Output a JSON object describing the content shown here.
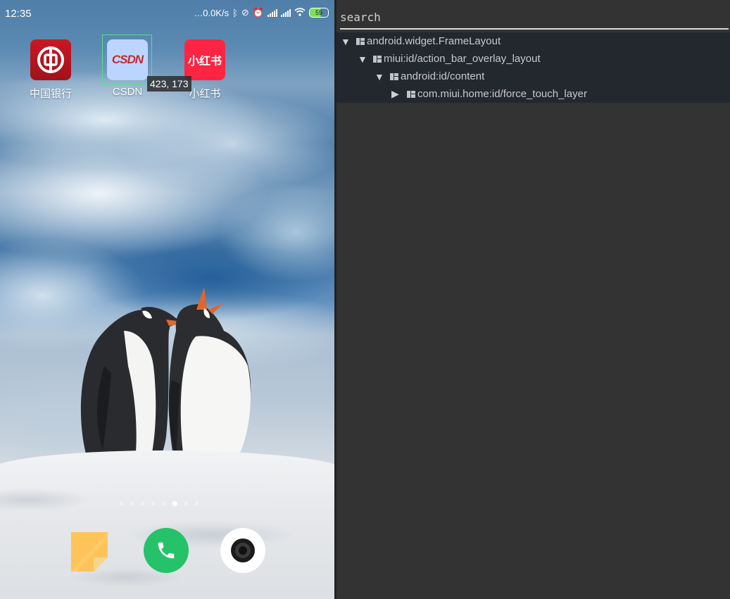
{
  "phone": {
    "status": {
      "time": "12:35",
      "net_speed": "…0.0K/s",
      "battery": "59",
      "icons": [
        "bluetooth-icon",
        "mute-icon",
        "alarm-icon",
        "signal-icon",
        "signal-icon",
        "wifi-icon",
        "battery-icon"
      ]
    },
    "apps": [
      {
        "name": "中国银行",
        "icon": "boc-icon"
      },
      {
        "name": "CSDN",
        "icon": "csdn-icon",
        "logo_text": "CSDN"
      },
      {
        "name": "小红书",
        "icon": "xiaohongshu-icon",
        "logo_text": "小红书"
      }
    ],
    "coordinate_readout": "423, 173",
    "page_dots": 8,
    "active_page": 6,
    "dock": [
      "notes-icon",
      "phone-icon",
      "camera-icon"
    ]
  },
  "inspector": {
    "search_placeholder": "search",
    "tree": [
      {
        "label": "android.widget.FrameLayout",
        "expanded": true
      },
      {
        "label": "miui:id/action_bar_overlay_layout",
        "expanded": true
      },
      {
        "label": "android:id/content",
        "expanded": true
      },
      {
        "label": "com.miui.home:id/force_touch_layer",
        "expanded": false
      }
    ]
  },
  "colors": {
    "selection_box": "#55e08a",
    "panel_bg": "#333333",
    "tree_bg": "#23272e",
    "phone_green": "#25c26a"
  }
}
